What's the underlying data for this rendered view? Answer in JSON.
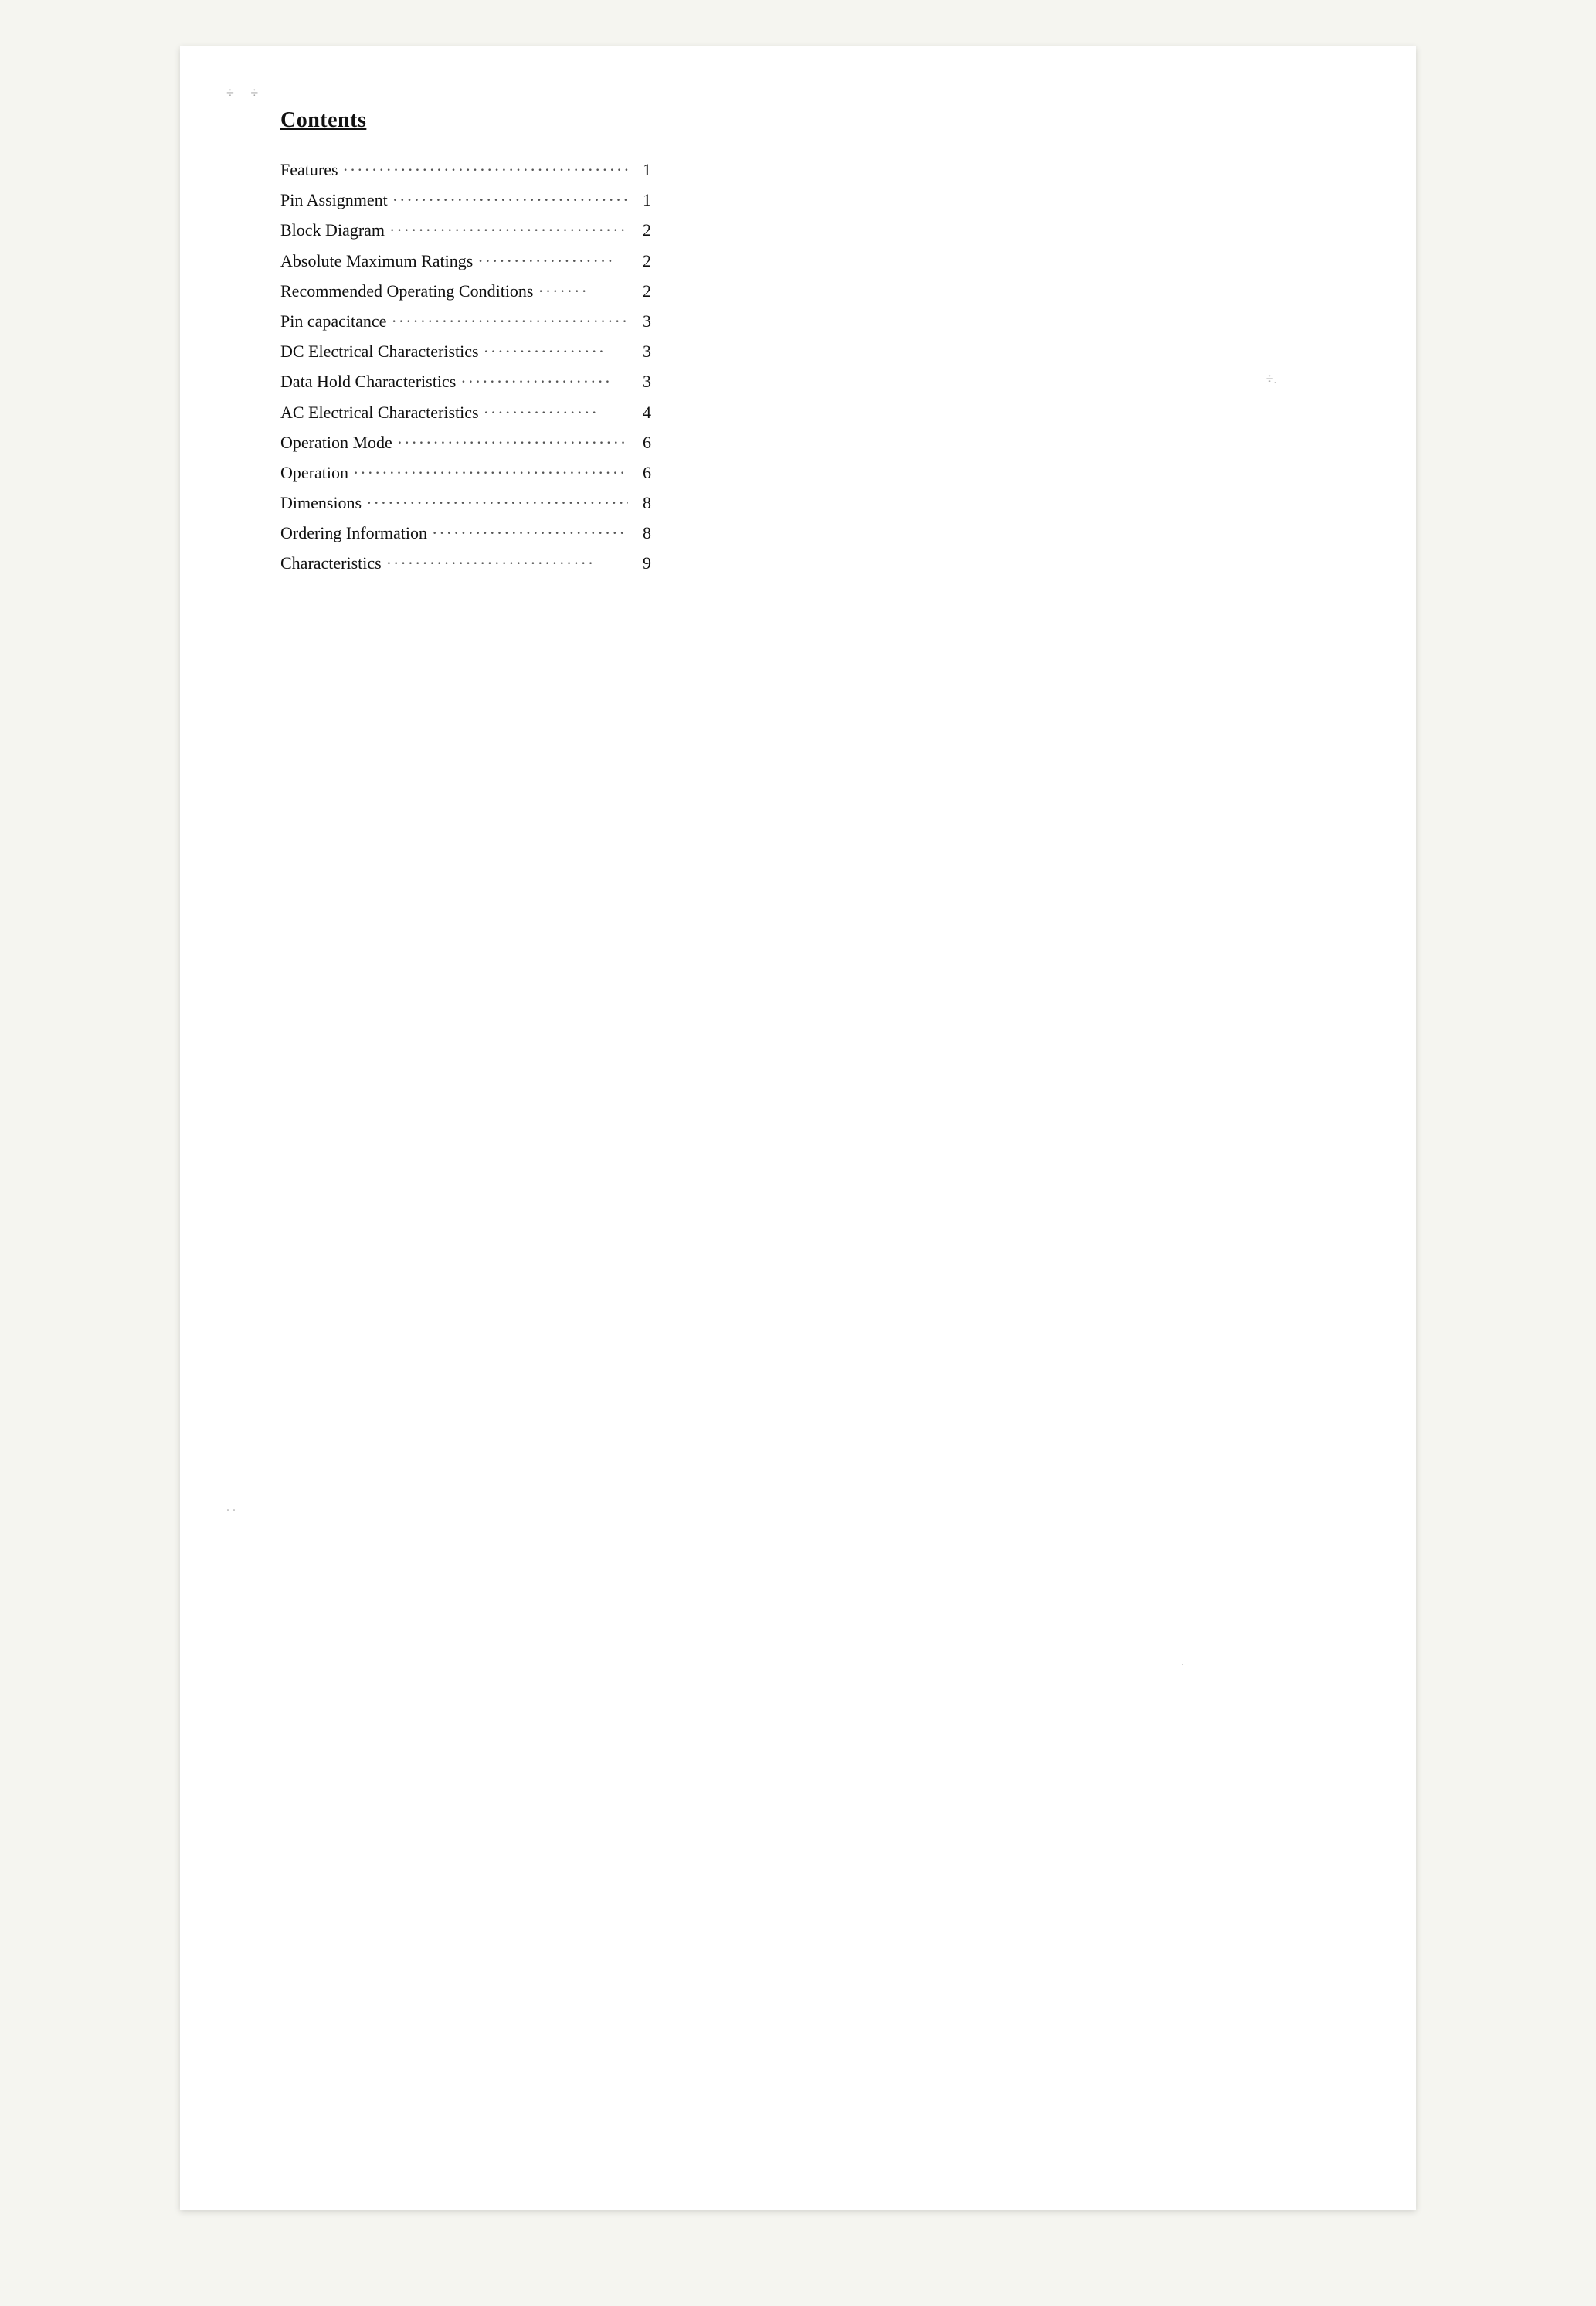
{
  "page": {
    "title": "Contents",
    "toc": [
      {
        "label": "Features",
        "dots": "·······························································",
        "page": "1"
      },
      {
        "label": "Pin Assignment",
        "dots": "··········································",
        "page": "1"
      },
      {
        "label": "Block Diagram",
        "dots": "··········································",
        "page": "2"
      },
      {
        "label": "Absolute Maximum Ratings",
        "dots": "···················",
        "page": "2"
      },
      {
        "label": "Recommended Operating Conditions",
        "dots": "·······",
        "page": "2"
      },
      {
        "label": "Pin capacitance",
        "dots": "·········································",
        "page": "3"
      },
      {
        "label": "DC Electrical Characteristics",
        "dots": "·················",
        "page": "3"
      },
      {
        "label": "Data Hold Characteristics",
        "dots": "·····················",
        "page": "3"
      },
      {
        "label": "AC Electrical Characteristics",
        "dots": "················",
        "page": "4"
      },
      {
        "label": "Operation Mode",
        "dots": "··········································",
        "page": "6"
      },
      {
        "label": "Operation",
        "dots": "·················································",
        "page": "6"
      },
      {
        "label": "Dimensions",
        "dots": "···············································",
        "page": "8"
      },
      {
        "label": "Ordering Information",
        "dots": "····························",
        "page": "8"
      },
      {
        "label": "Characteristics",
        "dots": "·····························",
        "page": "9"
      }
    ]
  }
}
